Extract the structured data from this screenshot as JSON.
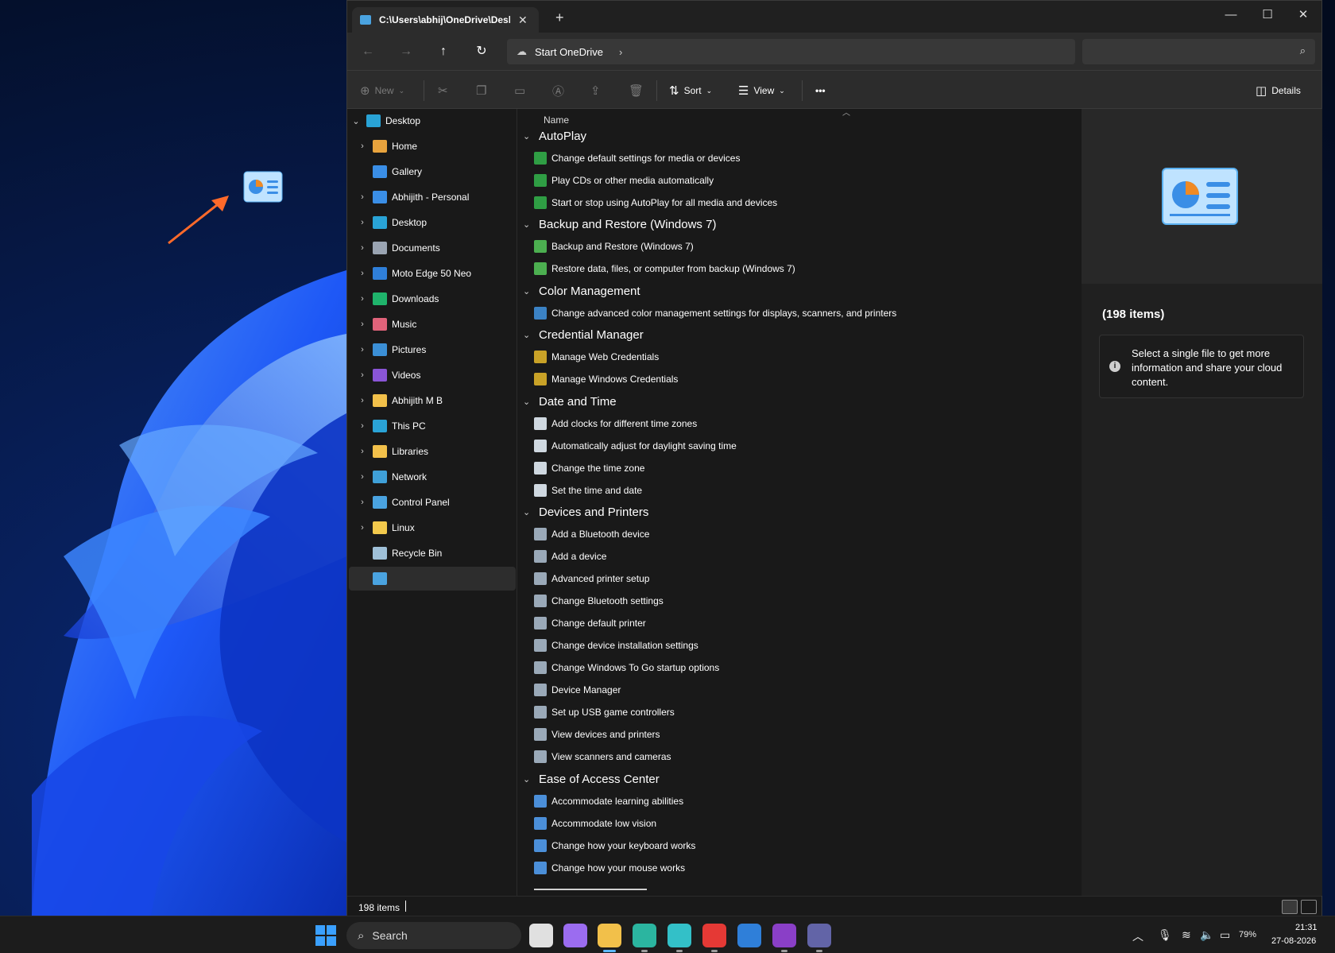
{
  "window": {
    "tab_title": "C:\\Users\\abhij\\OneDrive\\Desk",
    "address": "Start OneDrive",
    "search_placeholder": ""
  },
  "toolbar": {
    "new_label": "New",
    "sort_label": "Sort",
    "view_label": "View",
    "more_label": "•••",
    "details_label": "Details"
  },
  "nav": {
    "root": "Desktop",
    "items": [
      {
        "label": "Home",
        "icon": "home-icon",
        "color": "#e8a33d"
      },
      {
        "label": "Gallery",
        "icon": "gallery-icon",
        "color": "#3a8ee6"
      },
      {
        "label": "Abhijith - Personal",
        "icon": "onedrive-icon",
        "color": "#3a8ee6"
      },
      {
        "label": "Desktop",
        "icon": "desktop-folder-icon",
        "color": "#29a3d6"
      },
      {
        "label": "Documents",
        "icon": "documents-icon",
        "color": "#9aa4b2"
      },
      {
        "label": "Moto Edge 50 Neo",
        "icon": "phone-icon",
        "color": "#2f7fd9"
      },
      {
        "label": "Downloads",
        "icon": "downloads-icon",
        "color": "#1fb36b"
      },
      {
        "label": "Music",
        "icon": "music-icon",
        "color": "#e0637a"
      },
      {
        "label": "Pictures",
        "icon": "pictures-icon",
        "color": "#3b8fd6"
      },
      {
        "label": "Videos",
        "icon": "videos-icon",
        "color": "#8a55d6"
      },
      {
        "label": "Abhijith M B",
        "icon": "user-folder-icon",
        "color": "#f2c04a"
      },
      {
        "label": "This PC",
        "icon": "this-pc-icon",
        "color": "#2aa3d6"
      },
      {
        "label": "Libraries",
        "icon": "libraries-icon",
        "color": "#f2c04a"
      },
      {
        "label": "Network",
        "icon": "network-icon",
        "color": "#3fa0d8"
      },
      {
        "label": "Control Panel",
        "icon": "control-panel-icon",
        "color": "#4aa3e0"
      },
      {
        "label": "Linux",
        "icon": "linux-icon",
        "color": "#f2c94c"
      },
      {
        "label": "Recycle Bin",
        "icon": "recycle-bin-icon",
        "color": "#9fc0d8"
      },
      {
        "label": "",
        "icon": "control-panel-icon",
        "color": "#4aa3e0"
      }
    ]
  },
  "list": {
    "column_name": "Name",
    "groups": [
      {
        "name": "AutoPlay",
        "items": [
          "Change default settings for media or devices",
          "Play CDs or other media automatically",
          "Start or stop using AutoPlay for all media and devices"
        ]
      },
      {
        "name": "Backup and Restore (Windows 7)",
        "items": [
          "Backup and Restore (Windows 7)",
          "Restore data, files, or computer from backup (Windows 7)"
        ]
      },
      {
        "name": "Color Management",
        "items": [
          "Change advanced color management settings for displays, scanners, and printers"
        ]
      },
      {
        "name": "Credential Manager",
        "items": [
          "Manage Web Credentials",
          "Manage Windows Credentials"
        ]
      },
      {
        "name": "Date and Time",
        "items": [
          "Add clocks for different time zones",
          "Automatically adjust for daylight saving time",
          "Change the time zone",
          "Set the time and date"
        ]
      },
      {
        "name": "Devices and Printers",
        "items": [
          "Add a Bluetooth device",
          "Add a device",
          "Advanced printer setup",
          "Change Bluetooth settings",
          "Change default printer",
          "Change device installation settings",
          "Change Windows To Go startup options",
          "Device Manager",
          "Set up USB game controllers",
          "View devices and printers",
          "View scanners and cameras"
        ]
      },
      {
        "name": "Ease of Access Center",
        "items": [
          "Accommodate learning abilities",
          "Accommodate low vision",
          "Change how your keyboard works",
          "Change how your mouse works"
        ]
      }
    ],
    "group_icon_colors": [
      "#2f9e44",
      "#4caf50",
      "#3b82c4",
      "#c9a227",
      "#cfd8e0",
      "#9aa9b8",
      "#4b8fd9"
    ]
  },
  "details": {
    "count": "(198 items)",
    "info": "Select a single file to get more information and share your cloud content."
  },
  "status": {
    "count": "198 items"
  },
  "taskbar": {
    "search_label": "Search",
    "apps": [
      {
        "name": "task-view-icon",
        "color": "#e0e0e0"
      },
      {
        "name": "copilot-icon",
        "color": "#9b6cf0"
      },
      {
        "name": "file-explorer-icon",
        "color": "#f2c04a"
      },
      {
        "name": "edge-icon",
        "color": "#2bb5a0"
      },
      {
        "name": "edge-profile-icon",
        "color": "#33c0c8"
      },
      {
        "name": "youtube-icon",
        "color": "#e53935"
      },
      {
        "name": "bing-icon",
        "color": "#2f7fd9"
      },
      {
        "name": "onenote-icon",
        "color": "#8a3fc7"
      },
      {
        "name": "teams-icon",
        "color": "#6264a7"
      }
    ],
    "battery": "79%",
    "time": "21:31",
    "date": "27-08-2026"
  }
}
